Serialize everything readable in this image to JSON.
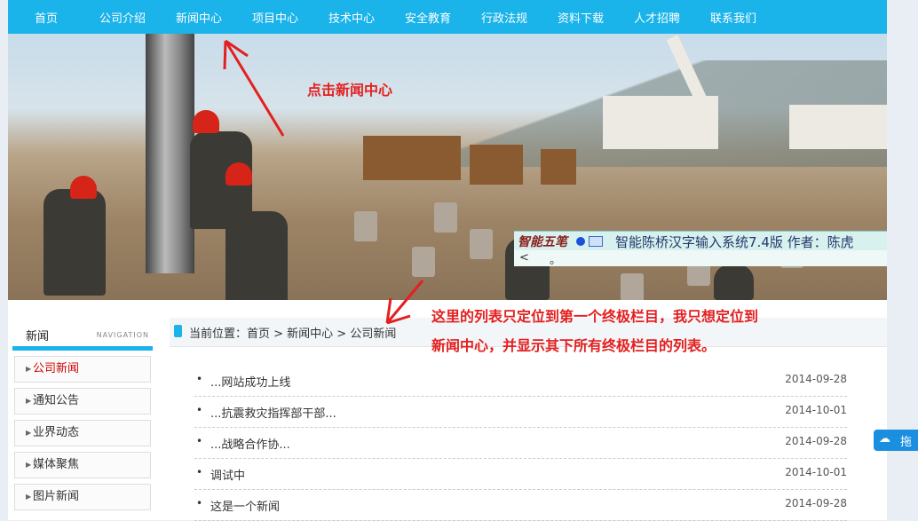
{
  "nav": {
    "items": [
      "首页",
      "公司介绍",
      "新闻中心",
      "项目中心",
      "技术中心",
      "安全教育",
      "行政法规",
      "资料下载",
      "人才招聘",
      "联系我们"
    ]
  },
  "annotations": {
    "click_hint": "点击新闻中心",
    "list_note_line1": "这里的列表只定位到第一个终极栏目，我只想定位到",
    "list_note_line2": "新闻中心，并显示其下所有终极栏目的列表。"
  },
  "ime": {
    "logo": "智能五笔",
    "status": "智能陈桥汉字输入系统7.4版  作者：陈虎",
    "row2_left": "<",
    "row2_char": "。"
  },
  "sidebar": {
    "title": "新闻",
    "subtitle": "NAVIGATION",
    "items": [
      {
        "label": "公司新闻",
        "active": true
      },
      {
        "label": "通知公告",
        "active": false
      },
      {
        "label": "业界动态",
        "active": false
      },
      {
        "label": "媒体聚焦",
        "active": false
      },
      {
        "label": "图片新闻",
        "active": false
      }
    ]
  },
  "breadcrumb": {
    "text": "当前位置：首页 > 新闻中心 > 公司新闻"
  },
  "news": [
    {
      "title": "...网站成功上线",
      "date": "2014-09-28"
    },
    {
      "title": "...抗震救灾指挥部干部...",
      "date": "2014-10-01"
    },
    {
      "title": "...战略合作协...",
      "date": "2014-09-28"
    },
    {
      "title": "调试中",
      "date": "2014-10-01"
    },
    {
      "title": "这是一个新闻",
      "date": "2014-09-28"
    }
  ],
  "float_tab": {
    "label": "拖"
  },
  "colors": {
    "accent": "#1ab3ea",
    "annotation": "#e41f1f",
    "active": "#cc0000"
  }
}
